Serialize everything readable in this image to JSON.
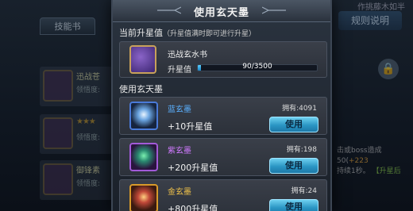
{
  "background": {
    "tab_label": "技能书",
    "items": [
      {
        "name": "迅战苍",
        "sub": "领悟度:"
      },
      {
        "name": "",
        "sub": "领悟度:"
      },
      {
        "name": "御锋素",
        "sub": "领悟度:"
      }
    ],
    "rule_button": "规则说明",
    "top_text": "作挑藤木如半",
    "desc_prefix": "击或boss造成50(",
    "desc_highlight": "+223",
    "desc_mid": "持续1秒。",
    "desc_tail": "【升星后"
  },
  "modal": {
    "title": "使用玄天墨",
    "current_section": "当前升星值",
    "current_note": "（升星值满时即可进行升星）",
    "book_name": "迅战玄水书",
    "progress_label": "升星值",
    "progress_text": "90/3500",
    "progress_value": 90,
    "progress_max": 3500,
    "use_section": "使用玄天墨",
    "items": [
      {
        "name": "蓝玄墨",
        "count": "拥有:4091",
        "gain": "+10升星值",
        "button": "使用",
        "color": "#5ab0ff",
        "icon": "blue-ink-icon"
      },
      {
        "name": "紫玄墨",
        "count": "拥有:198",
        "gain": "+200升星值",
        "button": "使用",
        "color": "#d07aff",
        "icon": "purple-ink-icon"
      },
      {
        "name": "金玄墨",
        "count": "拥有:24",
        "gain": "+800升星值",
        "button": "使用",
        "color": "#f0c24a",
        "icon": "gold-ink-icon"
      }
    ]
  }
}
